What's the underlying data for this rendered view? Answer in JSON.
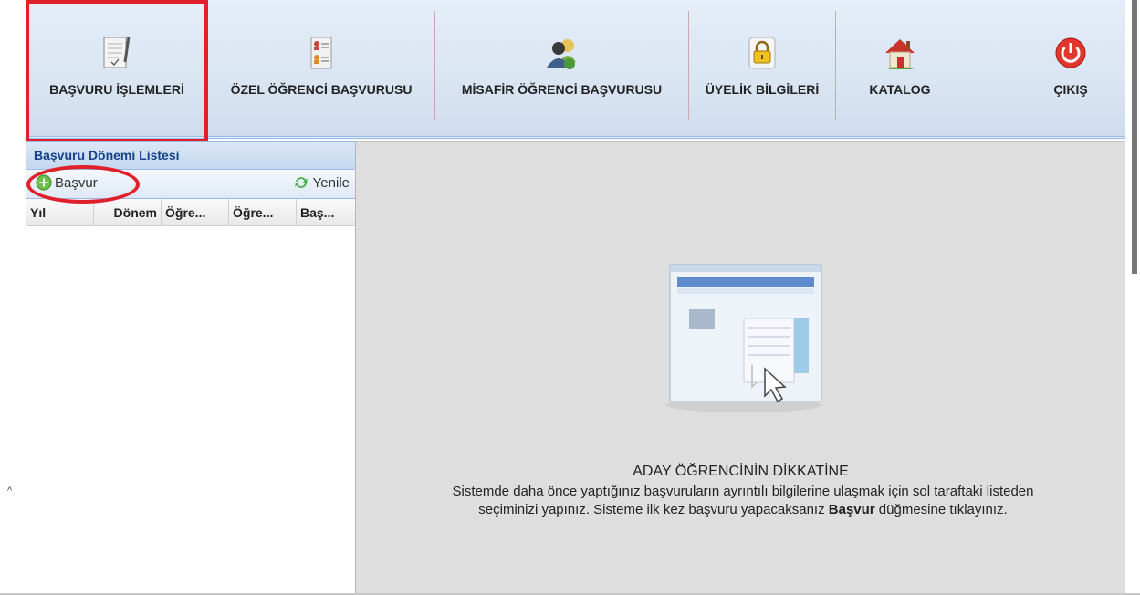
{
  "toolbar": {
    "items": [
      {
        "label": "BAŞVURU İŞLEMLERİ",
        "icon": "document-pen-icon",
        "selected": true
      },
      {
        "label": "ÖZEL ÖĞRENCİ BAŞVURUSU",
        "icon": "person-list-icon"
      },
      {
        "label": "MİSAFİR ÖĞRENCİ BAŞVURUSU",
        "icon": "users-icon"
      },
      {
        "label": "ÜYELİK BİLGİLERİ",
        "icon": "lock-icon"
      },
      {
        "label": "KATALOG",
        "icon": "home-icon"
      },
      {
        "label": "ÇIKIŞ",
        "icon": "power-icon"
      }
    ]
  },
  "left_panel": {
    "title": "Başvuru Dönemi Listesi",
    "apply_button": "Başvur",
    "refresh_button": "Yenile",
    "columns": [
      "Yıl",
      "Dönem",
      "Öğre...",
      "Öğre...",
      "Baş..."
    ]
  },
  "notice": {
    "title": "ADAY ÖĞRENCİNİN DİKKATİNE",
    "line1": "Sistemde daha önce yaptığınız başvuruların ayrıntılı bilgilerine ulaşmak için sol taraftaki listeden",
    "line2_pre": "seçiminizi yapınız. Sisteme ilk kez başvuru yapacaksanız ",
    "line2_bold": "Başvur",
    "line2_post": " düğmesine tıklayınız."
  },
  "colors": {
    "accent_blue": "#15428b",
    "highlight_red": "#e0202a",
    "main_bg": "#dedede"
  }
}
